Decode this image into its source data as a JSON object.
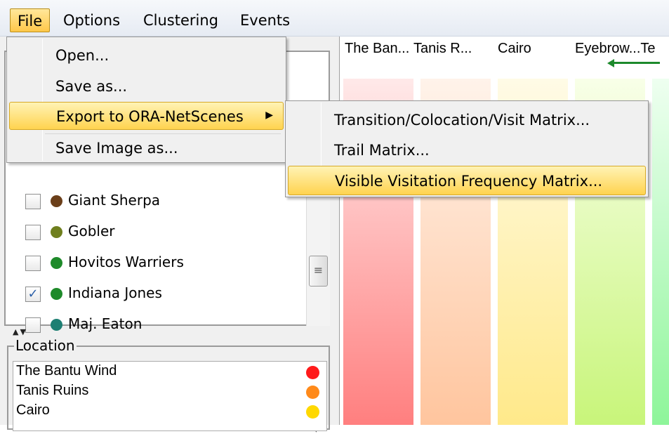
{
  "menubar": {
    "file": "File",
    "options": "Options",
    "clustering": "Clustering",
    "events": "Events"
  },
  "file_menu": {
    "items": [
      {
        "label": "Open..."
      },
      {
        "label": "Save as..."
      },
      {
        "label": "Export to ORA-NetScenes",
        "has_submenu": true,
        "highlighted": true
      },
      {
        "label": "Save Image as..."
      }
    ],
    "arrow": "▶"
  },
  "export_submenu": {
    "items": [
      {
        "label": "Transition/Colocation/Visit Matrix..."
      },
      {
        "label": "Trail Matrix..."
      },
      {
        "label": "Visible Visitation Frequency Matrix...",
        "highlighted": true
      }
    ]
  },
  "people": {
    "collapse_icon": "≫",
    "items": [
      {
        "label": "Giant Sherpa",
        "checked": false,
        "color": "#6b3f1a"
      },
      {
        "label": "Gobler",
        "checked": false,
        "color": "#6f7f1e"
      },
      {
        "label": "Hovitos Warriers",
        "checked": false,
        "color": "#1e8a2a"
      },
      {
        "label": "Indiana Jones",
        "checked": true,
        "color": "#1e8a2a"
      },
      {
        "label": "Maj. Eaton",
        "checked": false,
        "color": "#1e7f73"
      }
    ],
    "check_mark": "✓",
    "scroll_thumb": "≡",
    "scroll_down": "▼"
  },
  "splitter": "▲▼",
  "location": {
    "title": "Location",
    "items": [
      {
        "label": "The Bantu Wind",
        "color": "#ff1a1a"
      },
      {
        "label": "Tanis Ruins",
        "color": "#ff8a1a"
      },
      {
        "label": "Cairo",
        "color": "#ffd800"
      }
    ]
  },
  "timeline": {
    "columns": [
      {
        "label": "The Ban..."
      },
      {
        "label": "Tanis R..."
      },
      {
        "label": "Cairo"
      },
      {
        "label": "Eyebrow...Te"
      }
    ],
    "bands": [
      {
        "color_top": "#ffe9e9",
        "color_bottom": "#ff7f7f"
      },
      {
        "color_top": "#fff3ea",
        "color_bottom": "#ffc59e"
      },
      {
        "color_top": "#fffbe6",
        "color_bottom": "#ffe98a"
      },
      {
        "color_top": "#f8ffe8",
        "color_bottom": "#c8f57a"
      },
      {
        "color_top": "#eefff0",
        "color_bottom": "#8ef59a"
      }
    ]
  }
}
